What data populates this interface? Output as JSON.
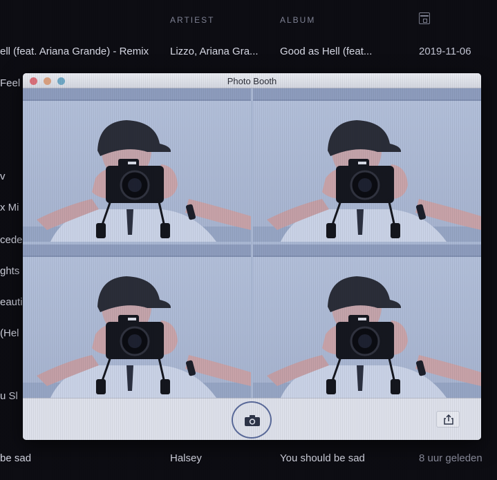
{
  "header": {
    "artist": "ARTIEST",
    "album": "ALBUM",
    "date_icon": "calendar-icon"
  },
  "rows": [
    {
      "title": "ell (feat. Ariana Grande) - Remix",
      "artist": "Lizzo, Ariana Gra...",
      "album": "Good as Hell (feat...",
      "date": "2019-11-06"
    },
    {
      "title": "be sad",
      "artist": "Halsey",
      "album": "You should be sad",
      "date": "8 uur geleden"
    }
  ],
  "left_fragments": [
    "Feel E",
    "v",
    "x Mi",
    "cede",
    "ghts",
    "eauti",
    "(Hel",
    "u Sl"
  ],
  "photobooth": {
    "title": "Photo Booth",
    "controls": {
      "close": "#d9707a",
      "minimize": "#d9a080",
      "zoom": "#6fa7c4"
    },
    "shutter_icon": "camera-icon",
    "share_icon": "share-icon"
  }
}
